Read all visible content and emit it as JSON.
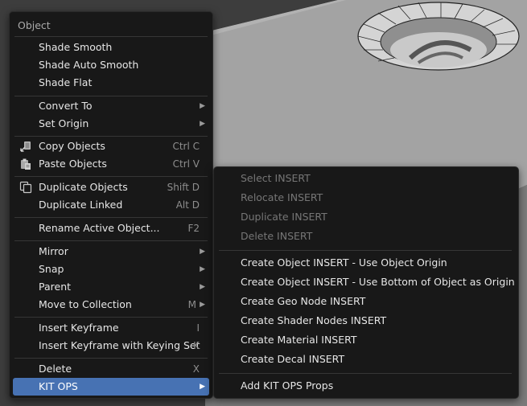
{
  "object_menu": {
    "title": "Object",
    "shade_smooth": "Shade Smooth",
    "shade_auto_smooth": "Shade Auto Smooth",
    "shade_flat": "Shade Flat",
    "convert_to": "Convert To",
    "set_origin": "Set Origin",
    "copy_objects": "Copy Objects",
    "copy_objects_shortcut": "Ctrl C",
    "paste_objects": "Paste Objects",
    "paste_objects_shortcut": "Ctrl V",
    "duplicate_objects": "Duplicate Objects",
    "duplicate_objects_shortcut": "Shift D",
    "duplicate_linked": "Duplicate Linked",
    "duplicate_linked_shortcut": "Alt D",
    "rename_active": "Rename Active Object...",
    "rename_active_shortcut": "F2",
    "mirror": "Mirror",
    "snap": "Snap",
    "parent": "Parent",
    "move_to_collection": "Move to Collection",
    "move_to_collection_shortcut": "M",
    "insert_keyframe": "Insert Keyframe",
    "insert_keyframe_shortcut": "I",
    "insert_keyframe_keying_set": "Insert Keyframe with Keying Set",
    "insert_keyframe_keying_set_shortcut": "K",
    "delete": "Delete",
    "delete_shortcut": "X",
    "kit_ops": "KIT OPS",
    "submenu_arrow": "▶"
  },
  "kitops_menu": {
    "select_insert": "Select INSERT",
    "relocate_insert": "Relocate INSERT",
    "duplicate_insert": "Duplicate INSERT",
    "delete_insert": "Delete INSERT",
    "create_object_insert_origin": "Create Object INSERT - Use Object Origin",
    "create_object_insert_bottom": "Create Object INSERT - Use Bottom of Object as Origin",
    "create_geo_node_insert": "Create Geo Node INSERT",
    "create_shader_nodes_insert": "Create Shader Nodes INSERT",
    "create_material_insert": "Create Material INSERT",
    "create_decal_insert": "Create Decal INSERT",
    "add_kit_ops_props": "Add KIT OPS Props"
  },
  "colors": {
    "menu_bg": "#181818",
    "highlight": "#4772b3",
    "viewport_bg": "#3d3d3d"
  }
}
